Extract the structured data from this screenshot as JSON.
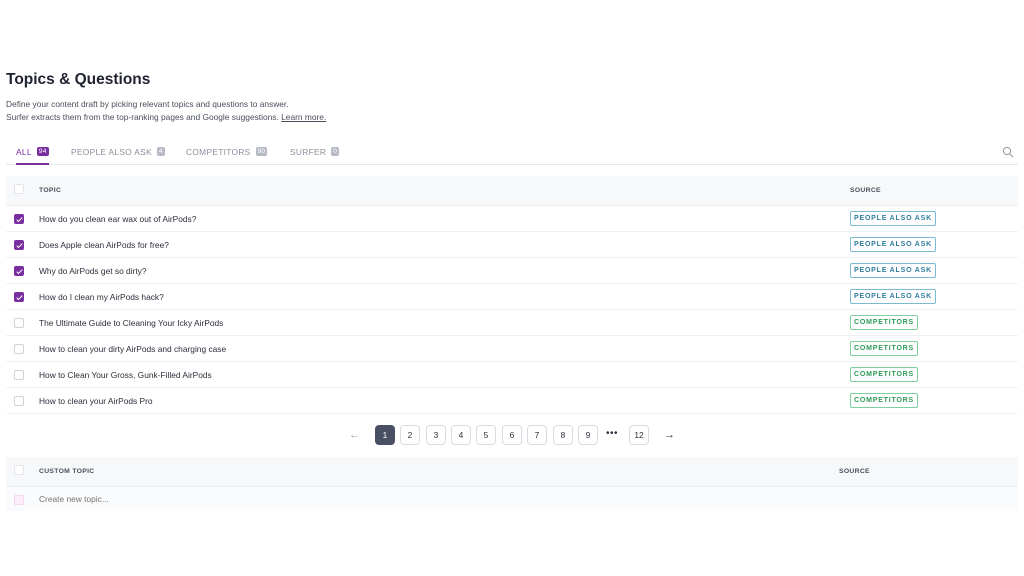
{
  "header": {
    "title": "Topics & Questions",
    "description_line1": "Define your content draft by picking relevant topics and questions to answer.",
    "description_line2": "Surfer extracts them from the top-ranking pages and Google suggestions.",
    "learn_more": "Learn more."
  },
  "tabs": [
    {
      "label": "ALL",
      "count": "94"
    },
    {
      "label": "PEOPLE ALSO ASK",
      "count": "4"
    },
    {
      "label": "COMPETITORS",
      "count": "90"
    },
    {
      "label": "SURFER",
      "count": "0"
    }
  ],
  "table": {
    "col_topic": "TOPIC",
    "col_source": "SOURCE",
    "rows": [
      {
        "topic": "How do you clean ear wax out of AirPods?",
        "source": "PEOPLE ALSO ASK",
        "checked": true
      },
      {
        "topic": "Does Apple clean AirPods for free?",
        "source": "PEOPLE ALSO ASK",
        "checked": true
      },
      {
        "topic": "Why do AirPods get so dirty?",
        "source": "PEOPLE ALSO ASK",
        "checked": true
      },
      {
        "topic": "How do I clean my AirPods hack?",
        "source": "PEOPLE ALSO ASK",
        "checked": true
      },
      {
        "topic": "The Ultimate Guide to Cleaning Your Icky AirPods",
        "source": "COMPETITORS",
        "checked": false
      },
      {
        "topic": "How to clean your dirty AirPods and charging case",
        "source": "COMPETITORS",
        "checked": false
      },
      {
        "topic": "How to Clean Your Gross, Gunk-Filled AirPods",
        "source": "COMPETITORS",
        "checked": false
      },
      {
        "topic": "How to clean your AirPods Pro",
        "source": "COMPETITORS",
        "checked": false
      }
    ]
  },
  "pagination": {
    "prev": "←",
    "next": "→",
    "pages": [
      "1",
      "2",
      "3",
      "4",
      "5",
      "6",
      "7",
      "8",
      "9"
    ],
    "ellipsis": "•••",
    "last": "12",
    "current": "1"
  },
  "custom": {
    "col_topic": "CUSTOM TOPIC",
    "col_source": "SOURCE",
    "placeholder": "Create new topic..."
  },
  "colors": {
    "accent": "#7a2fa0",
    "paa": "#2f7d9e",
    "competitors": "#2f9a58",
    "pager_active": "#4a5063"
  }
}
